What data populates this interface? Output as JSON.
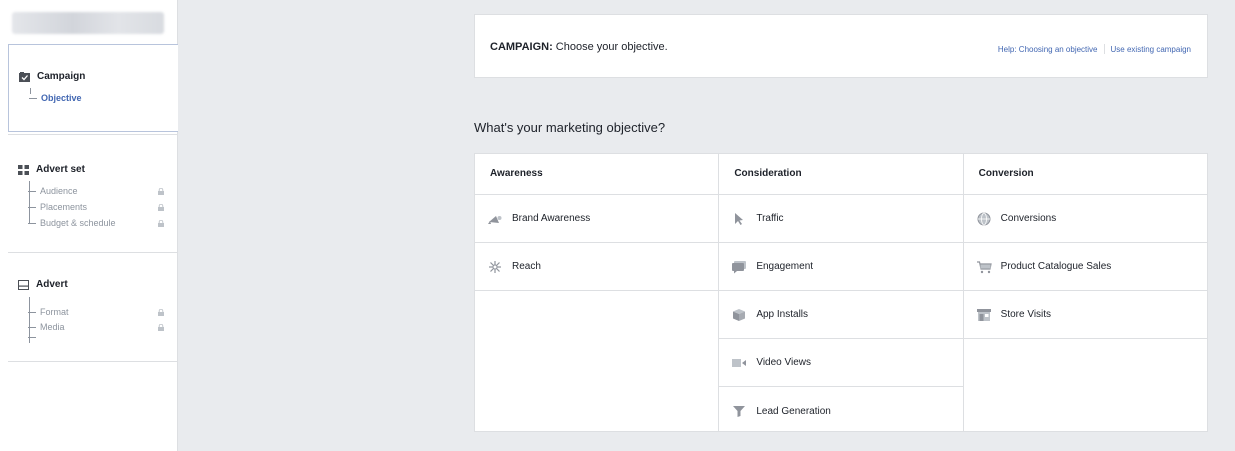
{
  "sidebar": {
    "campaign": {
      "title": "Campaign",
      "items": [
        {
          "label": "Objective",
          "active": true
        }
      ]
    },
    "advert_set": {
      "title": "Advert set",
      "items": [
        {
          "label": "Audience"
        },
        {
          "label": "Placements"
        },
        {
          "label": "Budget & schedule"
        }
      ]
    },
    "advert": {
      "title": "Advert",
      "items": [
        {
          "label": "Format"
        },
        {
          "label": "Media"
        }
      ]
    }
  },
  "header": {
    "label_strong": "CAMPAIGN:",
    "label_rest": " Choose your objective.",
    "help_link": "Help: Choosing an objective",
    "existing_link": "Use existing campaign"
  },
  "question": "What's your marketing objective?",
  "columns": [
    {
      "title": "Awareness",
      "options": [
        {
          "label": "Brand Awareness",
          "icon": "megaphone-icon"
        },
        {
          "label": "Reach",
          "icon": "reach-icon"
        }
      ]
    },
    {
      "title": "Consideration",
      "options": [
        {
          "label": "Traffic",
          "icon": "cursor-icon"
        },
        {
          "label": "Engagement",
          "icon": "chat-bubble-icon"
        },
        {
          "label": "App Installs",
          "icon": "box-icon"
        },
        {
          "label": "Video Views",
          "icon": "video-camera-icon"
        },
        {
          "label": "Lead Generation",
          "icon": "funnel-icon"
        }
      ]
    },
    {
      "title": "Conversion",
      "options": [
        {
          "label": "Conversions",
          "icon": "globe-icon"
        },
        {
          "label": "Product Catalogue Sales",
          "icon": "cart-icon"
        },
        {
          "label": "Store Visits",
          "icon": "store-icon"
        }
      ]
    }
  ],
  "colors": {
    "accent": "#4267b2",
    "icon_gray": "#90949c",
    "background": "#e9ebee"
  }
}
